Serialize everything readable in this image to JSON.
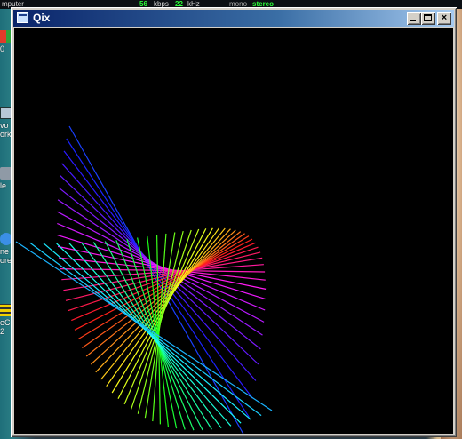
{
  "taskbar": {
    "label_left": "mputer",
    "bitrate_value": "56",
    "bitrate_unit": "kbps",
    "rate_value": "22",
    "rate_unit": "kHz",
    "mode_mono": "mono",
    "mode_stereo": "stereo"
  },
  "desktop_icons": [
    {
      "name": "windows-icon",
      "label": "0"
    },
    {
      "name": "network-icon",
      "label": "vo\nork"
    },
    {
      "name": "recycle-bin-icon",
      "label": "le"
    },
    {
      "name": "internet-explorer-icon",
      "label": "ne\nore"
    },
    {
      "name": "setup-icon",
      "label": "eC\n2"
    }
  ],
  "window": {
    "title": "Qix",
    "controls": {
      "minimize": "minimize",
      "maximize": "maximize",
      "close": "×"
    }
  },
  "qix": {
    "background": "#000000",
    "lines": 46
  }
}
